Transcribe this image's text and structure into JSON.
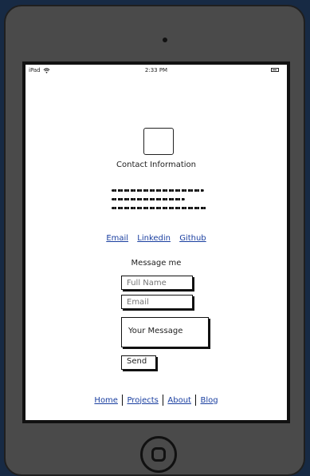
{
  "statusbar": {
    "device": "iPad",
    "time": "2:33 PM"
  },
  "profile": {
    "title": "Contact Information"
  },
  "links": {
    "email": "Email",
    "linkedin": "Linkedin",
    "github": "Github"
  },
  "form": {
    "heading": "Message me",
    "full_name_placeholder": "Full Name",
    "email_placeholder": "Email",
    "message_placeholder": "Your Message",
    "send_label": "Send"
  },
  "footer": {
    "home": "Home",
    "projects": "Projects",
    "about": "About",
    "blog": "Blog"
  },
  "colors": {
    "background": "#172a44",
    "device": "#4a4a4a",
    "link": "#1a3fa0"
  }
}
